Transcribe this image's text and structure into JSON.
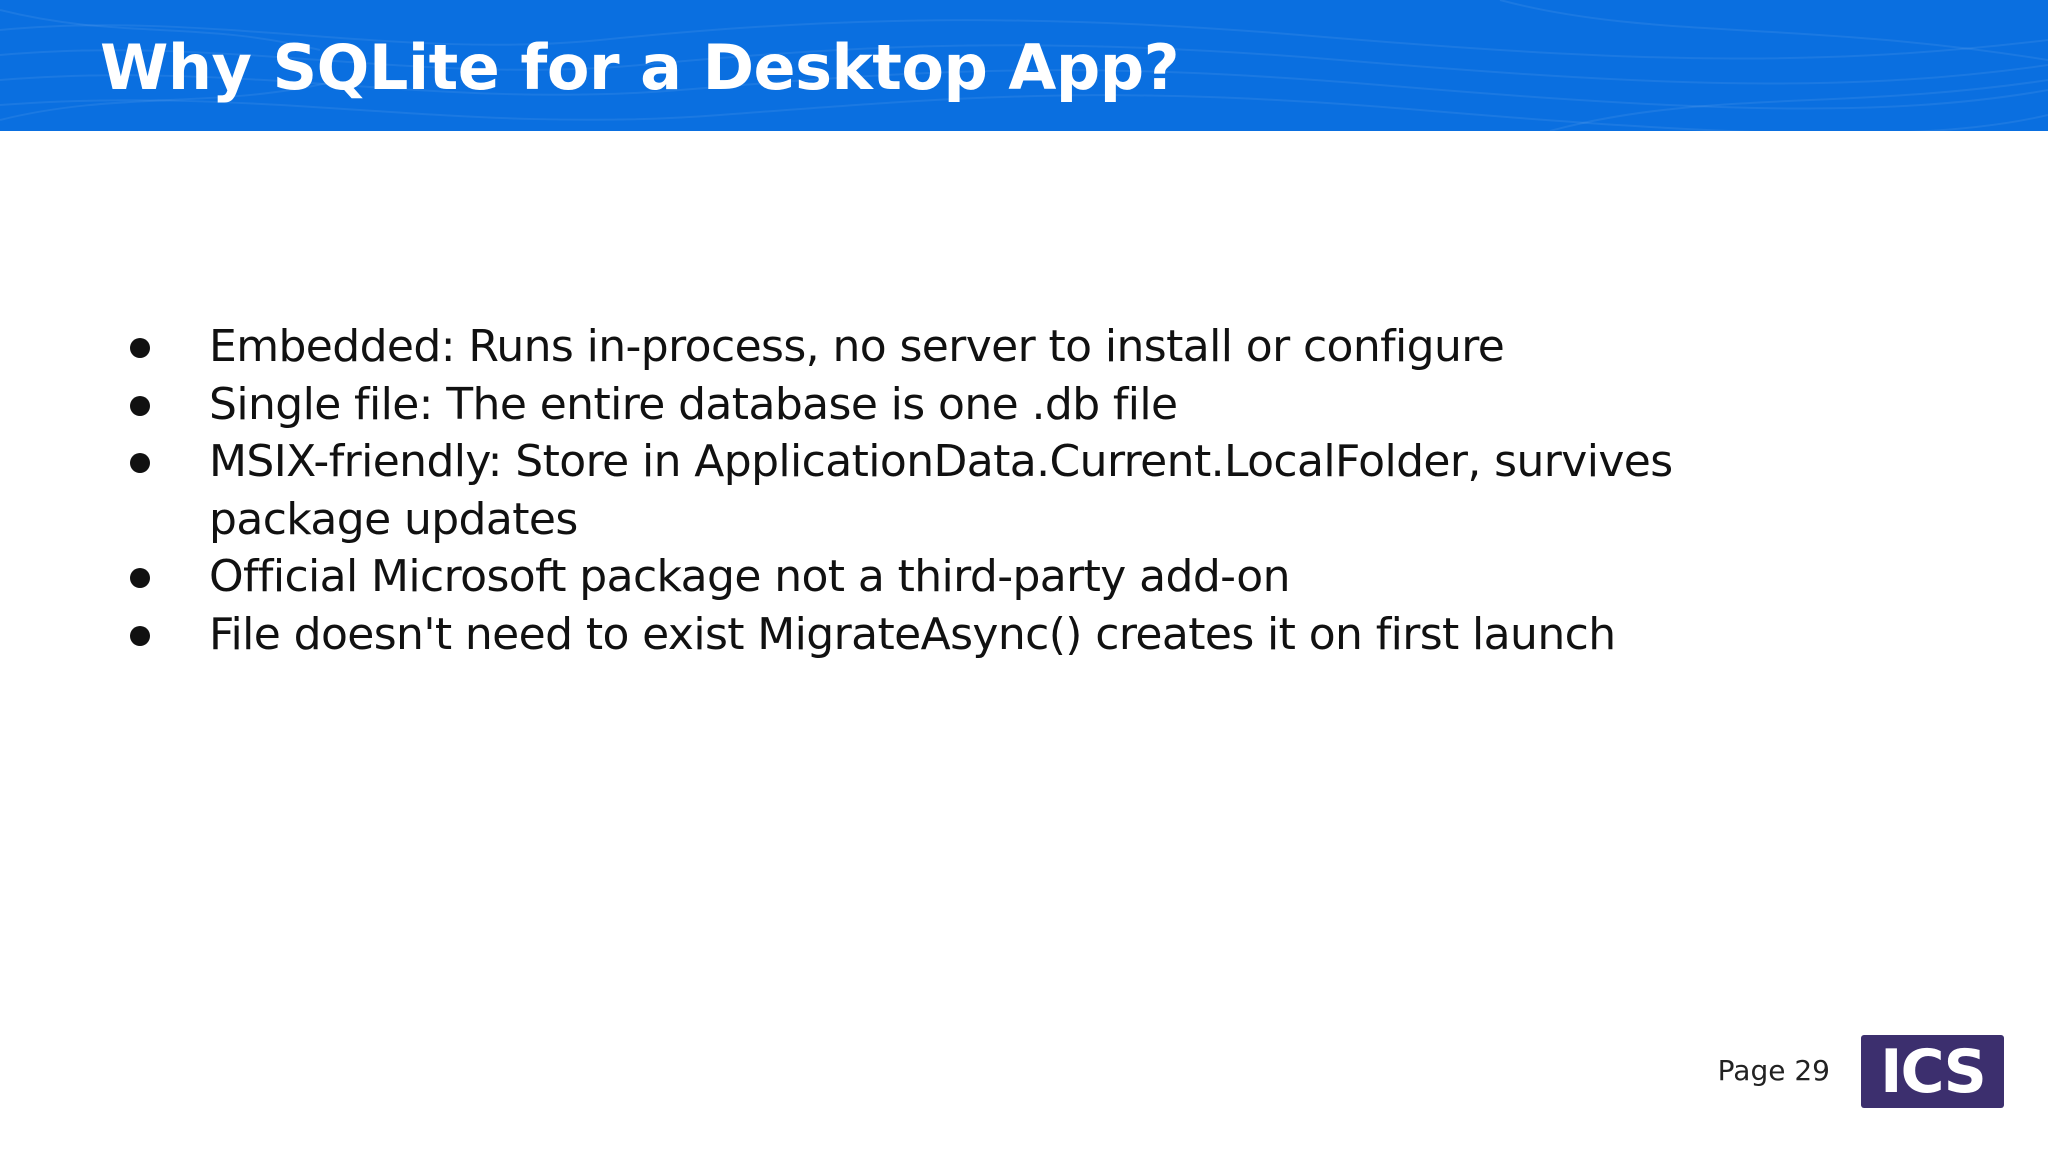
{
  "slide": {
    "title": "Why SQLite for a Desktop App?",
    "bullets": [
      "Embedded: Runs in-process, no server to install or configure",
      "Single file: The entire database is one .db file",
      "MSIX-friendly: Store in ApplicationData.Current.LocalFolder, survives package updates",
      "Official Microsoft package not a third-party add-on",
      "File doesn't need to exist MigrateAsync() creates it on first launch"
    ],
    "page_label": "Page 29",
    "logo_text": "ICS"
  },
  "colors": {
    "header_blue": "#0a6fe0",
    "logo_purple": "#3c2f6e",
    "body_text": "#111111"
  }
}
